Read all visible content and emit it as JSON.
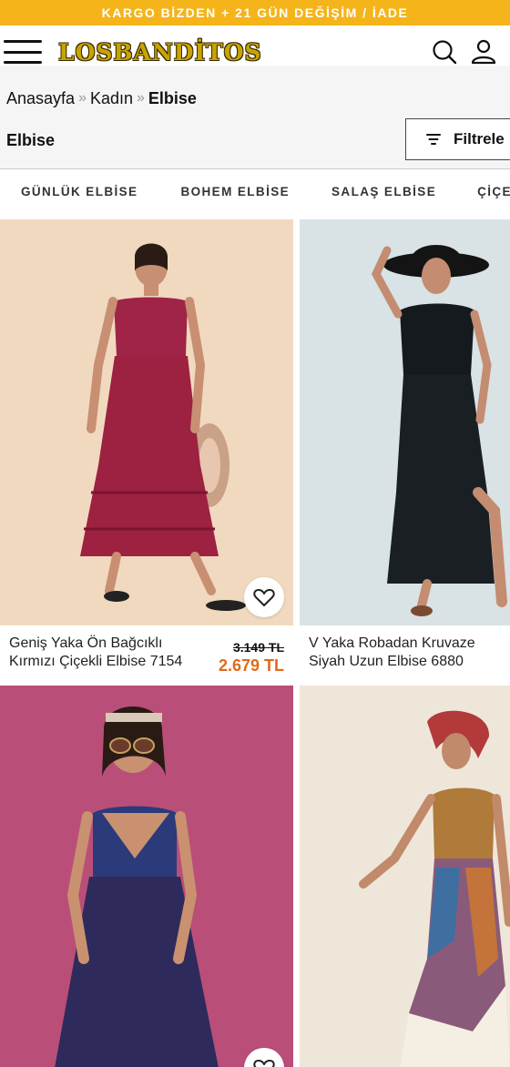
{
  "promo": {
    "text": "KARGO BİZDEN + 21 GÜN DEĞİŞİM / İADE"
  },
  "header": {
    "logo_text": "LOSBANDİTOS",
    "menu_icon": "hamburger-menu-icon",
    "search_icon": "search-icon",
    "account_icon": "user-icon"
  },
  "breadcrumb": {
    "items": [
      "Anasayfa",
      "Kadın",
      "Elbise"
    ],
    "separator": "»"
  },
  "page": {
    "title": "Elbise",
    "filter_label": "Filtrele"
  },
  "categories": [
    "GÜNLÜK ELBİSE",
    "BOHEM ELBİSE",
    "SALAŞ ELBİSE",
    "ÇİÇEKLİ"
  ],
  "products": [
    {
      "name": "Geniş Yaka Ön Bağcıklı Kırmızı Çiçekli Elbise 7154",
      "old_price": "3.149 TL",
      "price": "2.679 TL"
    },
    {
      "name": "V Yaka Robadan Kruvaze Siyah Uzun Elbise 6880"
    },
    {
      "name": ""
    },
    {
      "name": ""
    }
  ],
  "colors": {
    "promo_bg": "#f4b41a",
    "sale_price": "#e06a1a",
    "logo": "#c8a400"
  }
}
